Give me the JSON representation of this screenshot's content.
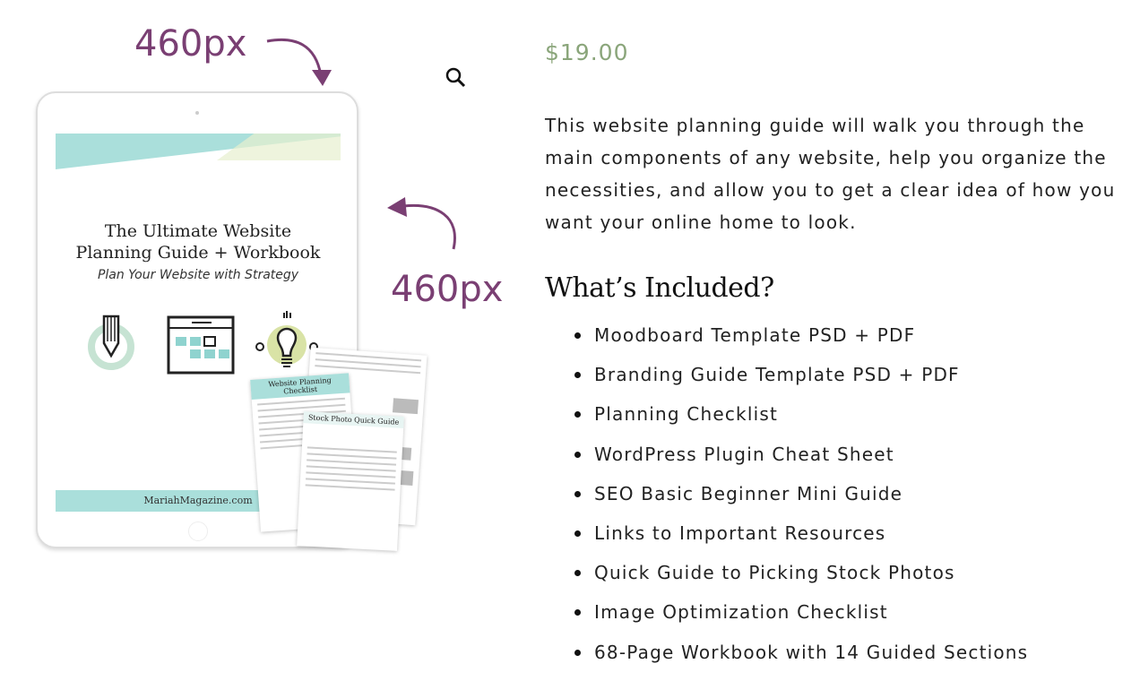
{
  "annotations": {
    "width_label": "460px",
    "height_label": "460px",
    "arrow_color": "#7a3f73"
  },
  "product_image": {
    "title_line1": "The Ultimate Website",
    "title_line2": "Planning Guide + Workbook",
    "subtitle": "Plan Your Website with Strategy",
    "footer": "MariahMagazine.com",
    "pages": [
      "Website Planning Checklist",
      "Stock Photo Quick Guide"
    ]
  },
  "zoom_icon": "magnifier-icon",
  "price": "$19.00",
  "description": "This website planning guide will walk you through the main components of any website, help you organize the necessities, and allow you to get a clear idea of how you want your online home to look.",
  "included": {
    "heading": "What’s Included?",
    "items": [
      "Moodboard Template PSD + PDF",
      "Branding Guide Template PSD + PDF",
      "Planning Checklist",
      "WordPress Plugin Cheat Sheet",
      "SEO Basic Beginner Mini Guide",
      "Links to Important Resources",
      "Quick Guide to Picking Stock Photos",
      "Image Optimization Checklist",
      "68-Page Workbook with 14 Guided Sections"
    ]
  },
  "colors": {
    "price": "#8aa57a",
    "accent_teal": "#aadfdb",
    "annotation": "#7a3f73"
  }
}
